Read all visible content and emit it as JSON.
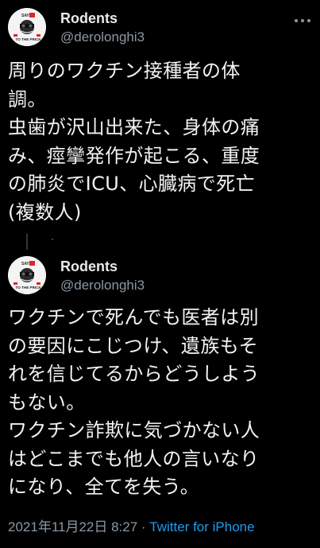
{
  "colors": {
    "background": "#000000",
    "text": "#e7e9ea",
    "secondary": "#8b98a5",
    "link": "#1d9bf0"
  },
  "tweets": [
    {
      "author": {
        "display_name": "Rodents",
        "handle": "@derolonghi3",
        "avatar_icon": "avatar-icon",
        "avatar_text_top": "SAY",
        "avatar_text_mid": "TO THE PRICK"
      },
      "text": "周りのワクチン接種者の体\n調。\n虫歯が沢山出来た、身体の痛\nみ、痙攣発作が起こる、重度\nの肺炎でICU、心臓病で死亡\n(複数人)"
    },
    {
      "author": {
        "display_name": "Rodents",
        "handle": "@derolonghi3",
        "avatar_icon": "avatar-icon",
        "avatar_text_top": "SAY",
        "avatar_text_mid": "TO THE PRICK"
      },
      "text": "ワクチンで死んでも医者は別\nの要因にこじつけ、遺族もそ\nれを信じてるからどうしよう\nもない。\nワクチン詐欺に気づかない人\nはどこまでも他人の言いなり\nになり、全てを失う。"
    }
  ],
  "footer": {
    "timestamp": "2021年11月22日 8:27",
    "separator": " · ",
    "source": "Twitter for iPhone"
  }
}
